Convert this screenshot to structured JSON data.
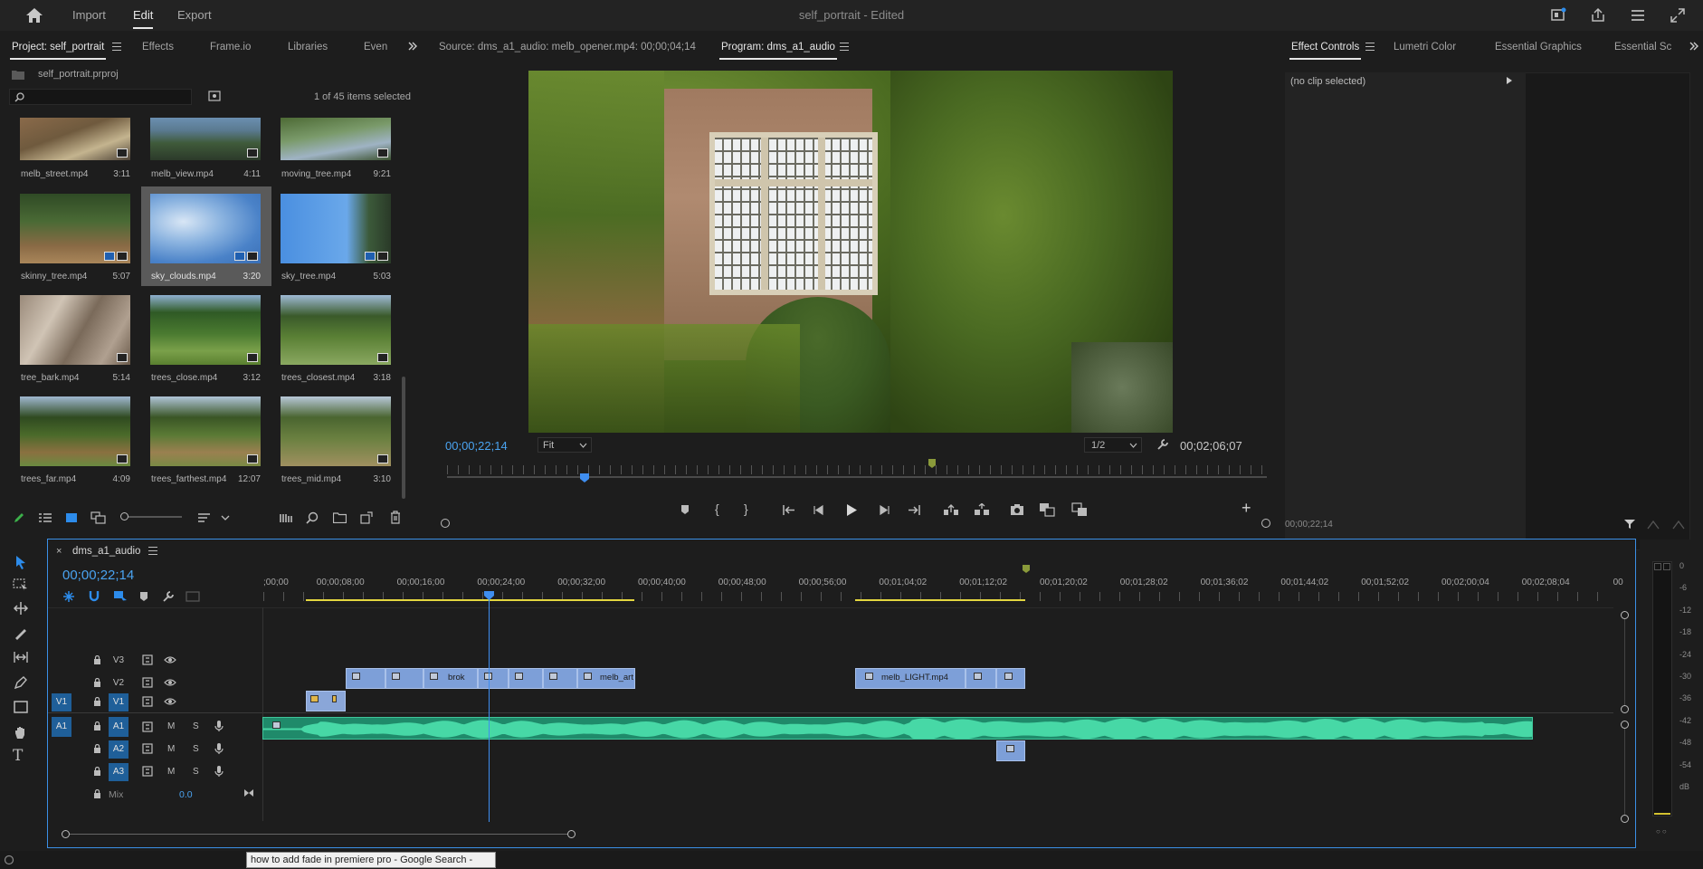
{
  "topbar": {
    "nav": [
      "Import",
      "Edit",
      "Export"
    ],
    "active": "Edit",
    "title": "self_portrait",
    "edited": " - Edited"
  },
  "project": {
    "tabs": [
      "Project: self_portrait",
      "Effects",
      "Frame.io",
      "Libraries",
      "Even"
    ],
    "file": "self_portrait.prproj",
    "search_placeholder": "",
    "items_selected": "1 of 45 items selected",
    "clips": [
      {
        "name": "melb_street.mp4",
        "dur": "3:11"
      },
      {
        "name": "melb_view.mp4",
        "dur": "4:11"
      },
      {
        "name": "moving_tree.mp4",
        "dur": "9:21"
      },
      {
        "name": "skinny_tree.mp4",
        "dur": "5:07"
      },
      {
        "name": "sky_clouds.mp4",
        "dur": "3:20"
      },
      {
        "name": "sky_tree.mp4",
        "dur": "5:03"
      },
      {
        "name": "tree_bark.mp4",
        "dur": "5:14"
      },
      {
        "name": "trees_close.mp4",
        "dur": "3:12"
      },
      {
        "name": "trees_closest.mp4",
        "dur": "3:18"
      },
      {
        "name": "trees_far.mp4",
        "dur": "4:09"
      },
      {
        "name": "trees_farthest.mp4",
        "dur": "12:07"
      },
      {
        "name": "trees_mid.mp4",
        "dur": "3:10"
      }
    ]
  },
  "monitor": {
    "source_tab": "Source: dms_a1_audio: melb_opener.mp4: 00;00;04;14",
    "program_tab": "Program: dms_a1_audio",
    "timecode": "00;00;22;14",
    "fit": "Fit",
    "resolution": "1/2",
    "duration": "00;02;06;07"
  },
  "effects": {
    "tabs": [
      "Effect Controls",
      "Lumetri Color",
      "Essential Graphics",
      "Essential Sc"
    ],
    "no_clip": "(no clip selected)",
    "timecode": "00;00;22;14"
  },
  "timeline": {
    "sequence": "dms_a1_audio",
    "timecode": "00;00;22;14",
    "ruler": [
      ";00;00",
      "00;00;08;00",
      "00;00;16;00",
      "00;00;24;00",
      "00;00;32;00",
      "00;00;40;00",
      "00;00;48;00",
      "00;00;56;00",
      "00;01;04;02",
      "00;01;12;02",
      "00;01;20;02",
      "00;01;28;02",
      "00;01;36;02",
      "00;01;44;02",
      "00;01;52;02",
      "00;02;00;04",
      "00;02;08;04",
      "00"
    ],
    "video_tracks": [
      "V3",
      "V2",
      "V1"
    ],
    "audio_tracks": [
      "A1",
      "A2",
      "A3"
    ],
    "source_v": "V1",
    "source_a": "A1",
    "mix_label": "Mix",
    "mix_value": "0.0",
    "clips": {
      "v2_a": "brok",
      "v2_b": "melb_art",
      "v2_c": "melb_LIGHT.mp4"
    },
    "track_letters": {
      "m": "M",
      "s": "S"
    }
  },
  "meter": {
    "scale": [
      "0",
      "-6",
      "-12",
      "-18",
      "-24",
      "-30",
      "-36",
      "-42",
      "-48",
      "-54",
      "dB"
    ],
    "solo": "S S"
  },
  "taskbar": {
    "tooltip": "how to add fade in premiere pro - Google Search -"
  },
  "colors": {
    "accent": "#2d8ceb",
    "timecode": "#4aa3f0",
    "clip_video": "#7d9fd8",
    "clip_audio": "#2fae88",
    "playhead": "#3f8ef0",
    "render_bar": "#e3d640"
  }
}
